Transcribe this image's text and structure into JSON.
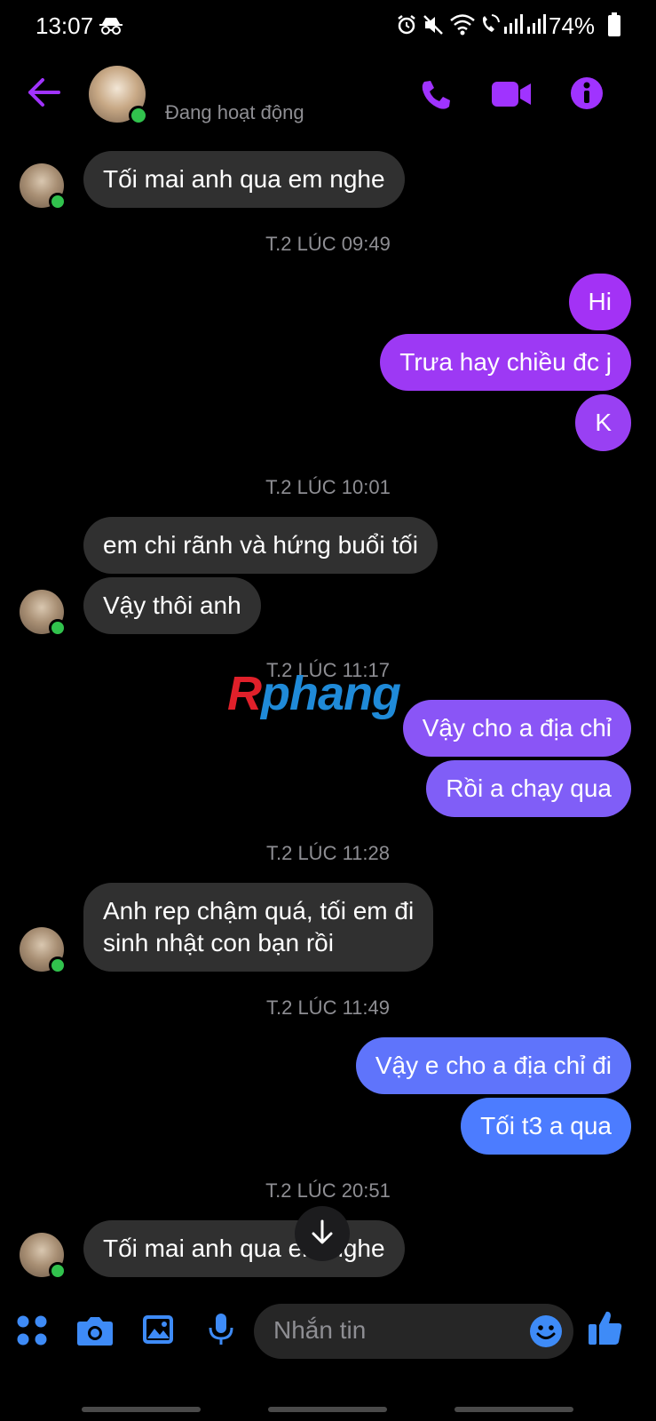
{
  "status_bar": {
    "time": "13:07",
    "battery": "74%"
  },
  "header": {
    "contact_status": "Đang hoạt động"
  },
  "messages": [
    {
      "type": "received",
      "text": "Tối mai anh qua em nghe"
    },
    {
      "type": "timestamp",
      "text": "T.2 LÚC 09:49"
    },
    {
      "type": "sent",
      "text": "Hi"
    },
    {
      "type": "sent",
      "text": "Trưa hay chiều đc j"
    },
    {
      "type": "sent",
      "text": "K"
    },
    {
      "type": "timestamp",
      "text": "T.2 LÚC 10:01"
    },
    {
      "type": "received",
      "text": "em chi rãnh và hứng buổi tối"
    },
    {
      "type": "received",
      "text": "Vậy thôi anh"
    },
    {
      "type": "timestamp",
      "text": "T.2 LÚC 11:17"
    },
    {
      "type": "sent",
      "text": "Vậy cho a địa chỉ"
    },
    {
      "type": "sent",
      "text": "Rồi a chạy qua"
    },
    {
      "type": "timestamp",
      "text": "T.2 LÚC 11:28"
    },
    {
      "type": "received",
      "text": "Anh rep chậm quá, tối em đi sinh nhật con bạn rồi",
      "line1": "Anh rep chậm quá, tối em đi",
      "line2": "sinh nhật con bạn rồi"
    },
    {
      "type": "timestamp",
      "text": "T.2 LÚC 11:49"
    },
    {
      "type": "sent",
      "text": "Vậy e cho a địa chỉ đi"
    },
    {
      "type": "sent",
      "text": "Tối t3 a qua"
    },
    {
      "type": "timestamp",
      "text": "T.2 LÚC 20:51"
    },
    {
      "type": "received",
      "text": "Tối mai anh qua em nghe"
    }
  ],
  "watermark": "Rphang",
  "composer": {
    "placeholder": "Nhắn tin"
  },
  "colors": {
    "accent": "#a033ff",
    "sent_top": "#a332f5",
    "sent_bottom": "#4c7cff",
    "received": "#303030",
    "online": "#31c24d"
  }
}
